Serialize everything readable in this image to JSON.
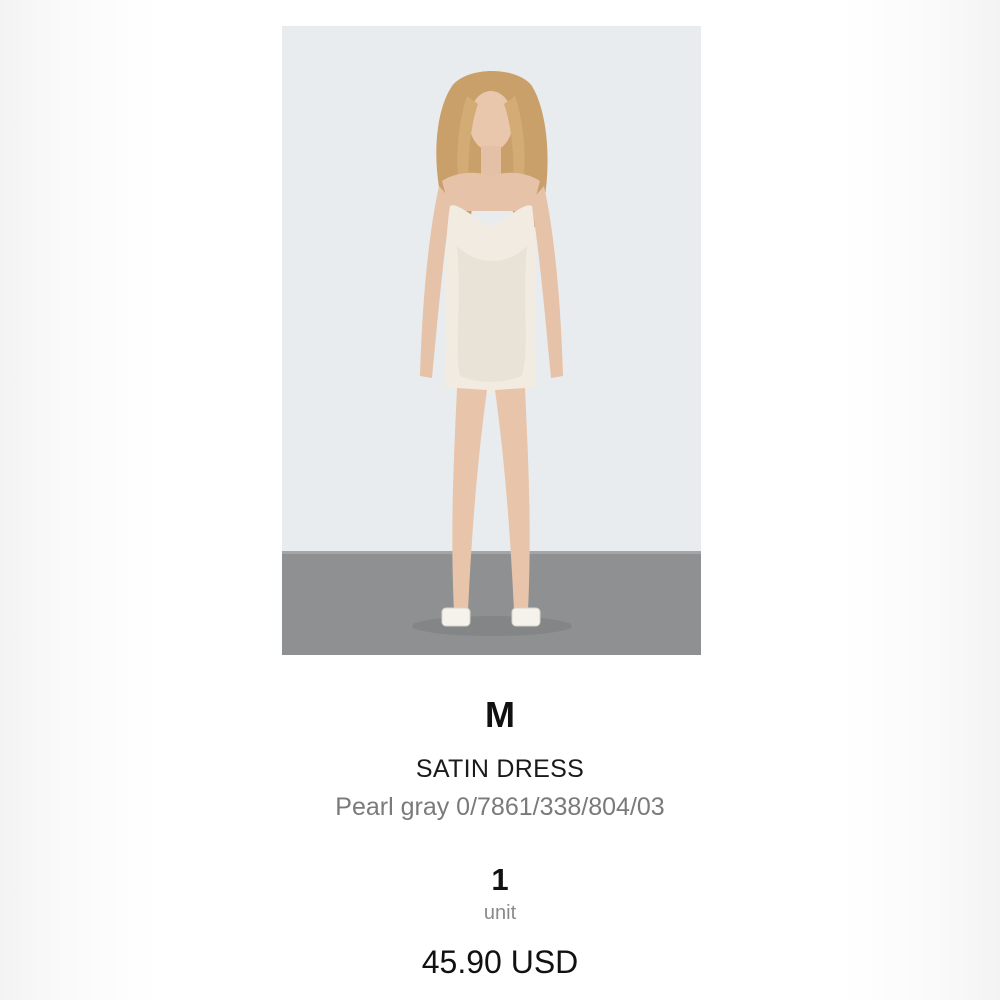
{
  "product": {
    "image_alt": "Model wearing pearl gray satin slip dress",
    "size": "M",
    "name": "SATIN DRESS",
    "color_ref": "Pearl gray 0/7861/338/804/03",
    "quantity": "1",
    "quantity_unit": "unit",
    "price": "45.90 USD"
  },
  "colors": {
    "wall": "#e8ebee",
    "floor": "#8f9192",
    "dress": "#efe9e0",
    "text_primary": "#111111",
    "text_secondary": "#7a7a7a"
  }
}
